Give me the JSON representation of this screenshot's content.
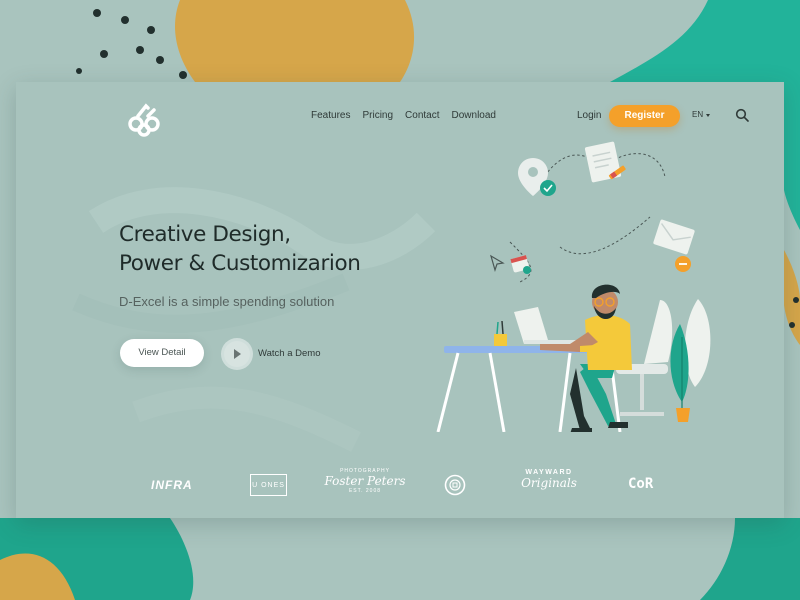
{
  "header": {
    "nav": [
      "Features",
      "Pricing",
      "Contact",
      "Download"
    ],
    "login": "Login",
    "register": "Register",
    "language": "EN"
  },
  "hero": {
    "title_line1": "Creative Design,",
    "title_line2": "Power & Customizarion",
    "subtitle": "D-Excel is a simple spending solution",
    "view_detail": "View Detail",
    "watch_demo": "Watch a Demo"
  },
  "brands": {
    "infra": "INFRA",
    "u_ones": "U ONES",
    "foster_top": "PHOTOGRAPHY",
    "foster_main": "Foster Peters",
    "foster_bottom": "EST. 2008",
    "wayward_top": "WAYWARD",
    "wayward_main": "Originals",
    "cor": "CoR"
  },
  "icons": [
    "logo-mark-icon",
    "search-icon",
    "caret-down-icon",
    "play-icon",
    "location-pin-icon",
    "document-icon",
    "pencil-icon",
    "envelope-icon",
    "check-badge-icon",
    "calendar-icon",
    "cursor-icon",
    "coin-icon"
  ],
  "colors": {
    "accent_orange": "#f4a02a",
    "brand_teal": "#1fa58c",
    "mustard": "#d6a64a",
    "card_bg": "#a8c3bd"
  }
}
